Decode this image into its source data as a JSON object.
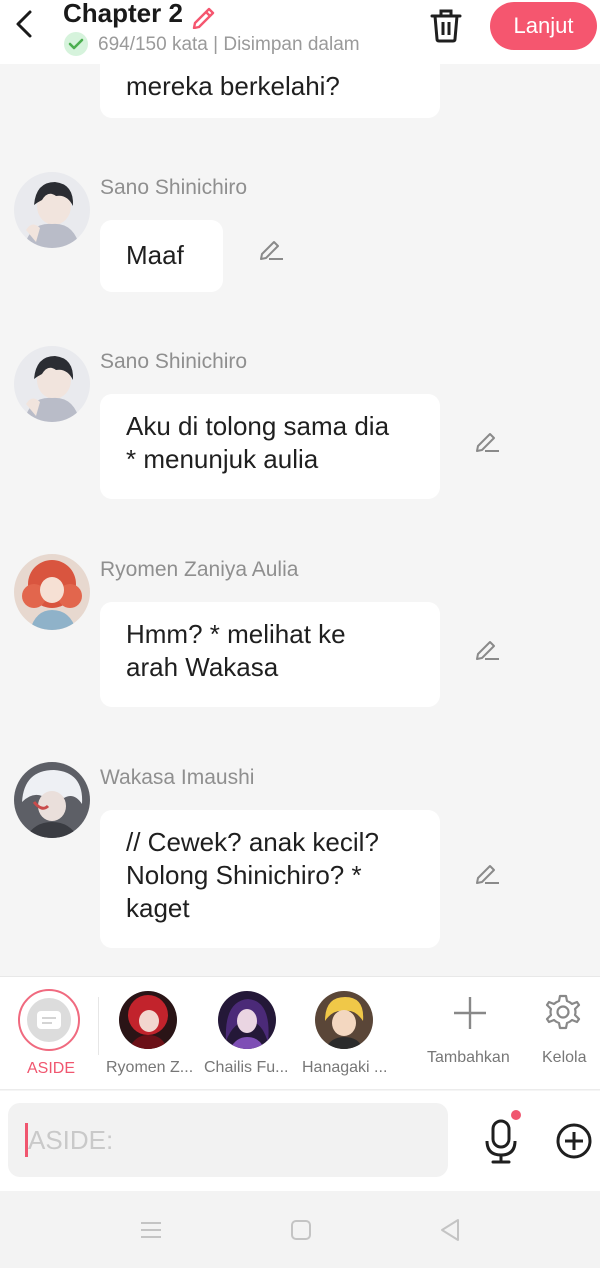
{
  "header": {
    "title": "Chapter 2",
    "subtitle": "694/150 kata | Disimpan dalam",
    "continue_label": "Lanjut"
  },
  "messages": [
    {
      "lines": [
        "mereka berkelahi?"
      ]
    },
    {
      "sender": "Sano Shinichiro",
      "lines": [
        "Maaf"
      ]
    },
    {
      "sender": "Sano Shinichiro",
      "lines": [
        "Aku di tolong sama dia",
        "* menunjuk aulia"
      ]
    },
    {
      "sender": "Ryomen Zaniya Aulia",
      "lines": [
        "Hmm? * melihat ke",
        "arah Wakasa"
      ]
    },
    {
      "sender": "Wakasa Imaushi",
      "lines": [
        "// Cewek? anak kecil?",
        "Nolong Shinichiro? *",
        "kaget"
      ]
    }
  ],
  "characters": {
    "aside": "ASIDE",
    "items": [
      {
        "label": "Ryomen Z..."
      },
      {
        "label": "Chailis Fu..."
      },
      {
        "label": "Hanagaki ..."
      }
    ],
    "add_label": "Tambahkan",
    "manage_label": "Kelola"
  },
  "input": {
    "placeholder": "ASIDE:"
  },
  "icons": {
    "back": "chevron-left-icon",
    "title_edit": "pencil-icon",
    "saved": "check-circle-icon",
    "delete": "trash-icon",
    "message_edit": "pencil-icon",
    "aside": "message-icon",
    "add": "plus-icon",
    "manage": "gear-icon",
    "mic": "microphone-icon",
    "more": "plus-circle-icon"
  },
  "colors": {
    "accent": "#f5566f",
    "background": "#f5f5f5",
    "bubble": "#ffffff",
    "saved_check": "#4caf50"
  }
}
